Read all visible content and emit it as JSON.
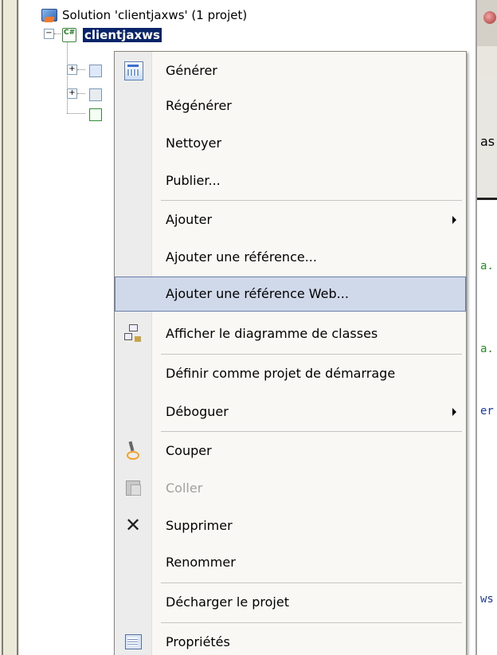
{
  "tree": {
    "solution_label": "Solution 'clientjaxws' (1 projet)",
    "project_label": "clientjaxws"
  },
  "editor": {
    "fragments": [
      "as",
      "a.",
      "a.",
      "er",
      "ws"
    ]
  },
  "context_menu": {
    "items": [
      {
        "label": "Générer",
        "icon": "build-icon",
        "enabled": true
      },
      {
        "label": "Régénérer",
        "enabled": true
      },
      {
        "label": "Nettoyer",
        "enabled": true
      },
      {
        "label": "Publier...",
        "enabled": true
      },
      {
        "label": "Ajouter",
        "submenu": true,
        "enabled": true
      },
      {
        "label": "Ajouter une référence...",
        "enabled": true
      },
      {
        "label": "Ajouter une référence Web...",
        "highlighted": true,
        "enabled": true
      },
      {
        "label": "Afficher le diagramme de classes",
        "icon": "class-diagram-icon",
        "enabled": true
      },
      {
        "label": "Définir comme projet de démarrage",
        "enabled": true
      },
      {
        "label": "Déboguer",
        "submenu": true,
        "enabled": true
      },
      {
        "label": "Couper",
        "icon": "cut-icon",
        "enabled": true
      },
      {
        "label": "Coller",
        "icon": "paste-icon",
        "enabled": false
      },
      {
        "label": "Supprimer",
        "icon": "delete-icon",
        "enabled": true
      },
      {
        "label": "Renommer",
        "enabled": true
      },
      {
        "label": "Décharger le projet",
        "enabled": true
      },
      {
        "label": "Propriétés",
        "icon": "properties-icon",
        "enabled": true
      }
    ],
    "highlight_color": "#cfd9e9",
    "highlight_border": "#6b7fa8"
  }
}
